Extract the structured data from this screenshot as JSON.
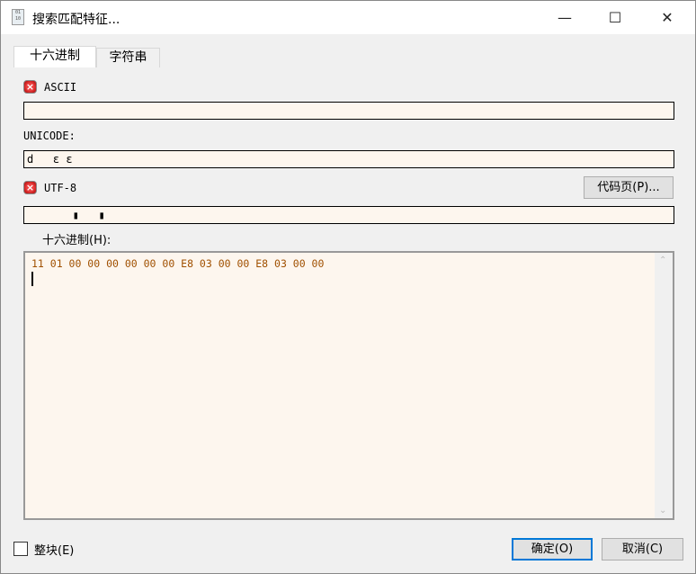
{
  "window": {
    "title": "搜索匹配特征...",
    "icon_text": "01\n10"
  },
  "tabs": [
    {
      "label": "十六进制"
    },
    {
      "label": "字符串"
    }
  ],
  "ascii": {
    "label": "ASCII",
    "value": ""
  },
  "unicode": {
    "label": "UNICODE:",
    "value": "d   ɛ ɛ"
  },
  "utf8": {
    "label": "UTF-8",
    "value": "       ▮   ▮",
    "codepage_button": "代码页(P)..."
  },
  "hex": {
    "label": "十六进制(H):",
    "value": "11 01 00 00 00 00 00 00 E8 03 00 00 E8 03 00 00"
  },
  "whole_block": {
    "label": "整块(E)",
    "checked": false
  },
  "buttons": {
    "ok": "确定(O)",
    "cancel": "取消(C)"
  }
}
